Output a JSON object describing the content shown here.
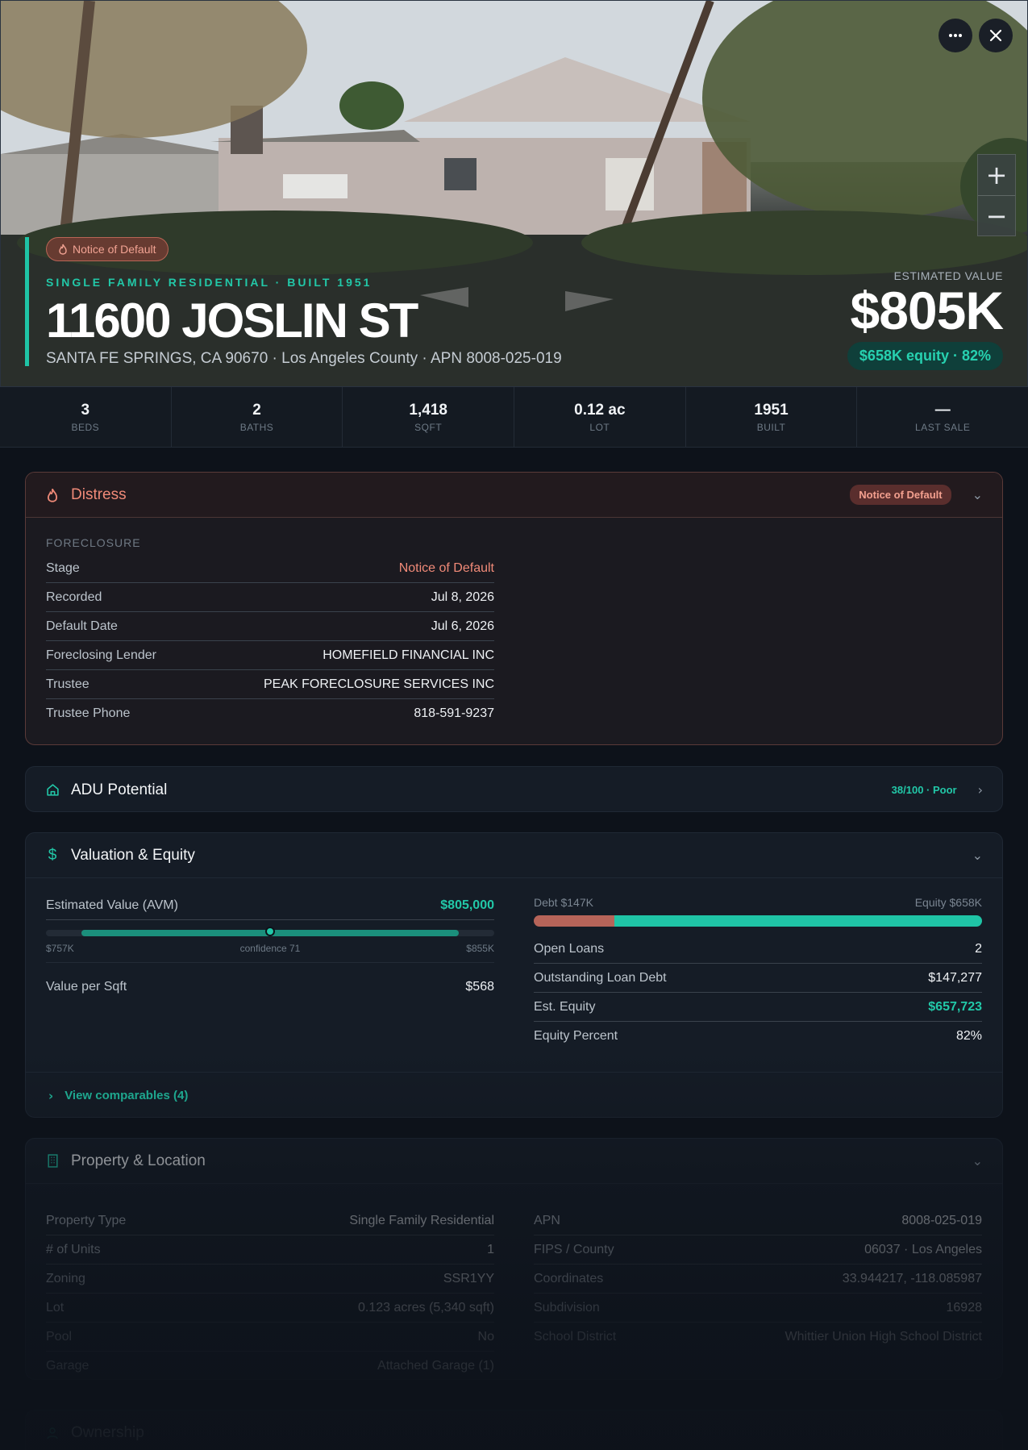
{
  "hero": {
    "badge": "Notice of Default",
    "subtitle": "SINGLE FAMILY RESIDENTIAL · BUILT 1951",
    "address": "11600 JOSLIN ST",
    "address_sub": "SANTA FE SPRINGS, CA 90670 · Los Angeles County · APN 8008-025-019",
    "estimated_label": "ESTIMATED VALUE",
    "estimated_value": "$805K",
    "equity_pill": "$658K equity · 82%",
    "more_icon": "more-icon",
    "close_icon": "close-icon",
    "zoom_in": "+",
    "zoom_out": "−"
  },
  "stats": [
    {
      "value": "3",
      "label": "BEDS"
    },
    {
      "value": "2",
      "label": "BATHS"
    },
    {
      "value": "1,418",
      "label": "SQFT"
    },
    {
      "value": "0.12 ac",
      "label": "LOT"
    },
    {
      "value": "1951",
      "label": "BUILT"
    },
    {
      "value": "—",
      "label": "LAST SALE"
    }
  ],
  "distress": {
    "title": "Distress",
    "badge": "Notice of Default",
    "section": "FORECLOSURE",
    "rows": [
      {
        "k": "Stage",
        "v": "Notice of Default"
      },
      {
        "k": "Recorded",
        "v": "Jul 8, 2026"
      },
      {
        "k": "Default Date",
        "v": "Jul 6, 2026"
      },
      {
        "k": "Foreclosing Lender",
        "v": "HOMEFIELD FINANCIAL INC"
      },
      {
        "k": "Trustee",
        "v": "PEAK FORECLOSURE SERVICES INC"
      },
      {
        "k": "Trustee Phone",
        "v": "818-591-9237"
      }
    ]
  },
  "adu": {
    "title": "ADU Potential",
    "score": "38/100 · Poor"
  },
  "valuation": {
    "title": "Valuation & Equity",
    "avm_label": "Estimated Value (AVM)",
    "avm_value": "$805,000",
    "range_low": "$757K",
    "confidence": "confidence 71",
    "range_high": "$855K",
    "confidence_position": 0.5,
    "per_sqft_label": "Value per Sqft",
    "per_sqft_value": "$568",
    "debt_label": "Debt $147K",
    "equity_label": "Equity $658K",
    "debt_fraction": 0.18,
    "rows": [
      {
        "k": "Open Loans",
        "v": "2"
      },
      {
        "k": "Outstanding Loan Debt",
        "v": "$147,277"
      },
      {
        "k": "Est. Equity",
        "v": "$657,723"
      },
      {
        "k": "Equity Percent",
        "v": "82%"
      }
    ],
    "comparables": "View comparables (4)"
  },
  "property": {
    "title": "Property & Location",
    "left": [
      {
        "k": "Property Type",
        "v": "Single Family Residential"
      },
      {
        "k": "# of Units",
        "v": "1"
      },
      {
        "k": "Zoning",
        "v": "SSR1YY"
      },
      {
        "k": "Lot",
        "v": "0.123 acres (5,340 sqft)"
      },
      {
        "k": "Pool",
        "v": "No"
      },
      {
        "k": "Garage",
        "v": "Attached Garage (1)"
      }
    ],
    "right": [
      {
        "k": "APN",
        "v": "8008-025-019"
      },
      {
        "k": "FIPS / County",
        "v": "06037 · Los Angeles"
      },
      {
        "k": "Coordinates",
        "v": "33.944217, -118.085987"
      },
      {
        "k": "Subdivision",
        "v": "16928"
      },
      {
        "k": "School District",
        "v": "Whittier Union High School District"
      }
    ]
  },
  "ownership": {
    "title": "Ownership"
  },
  "colors": {
    "accent": "#22c8a8",
    "distress": "#f08a78",
    "debt": "#b66459",
    "bg": "#0d121a"
  }
}
